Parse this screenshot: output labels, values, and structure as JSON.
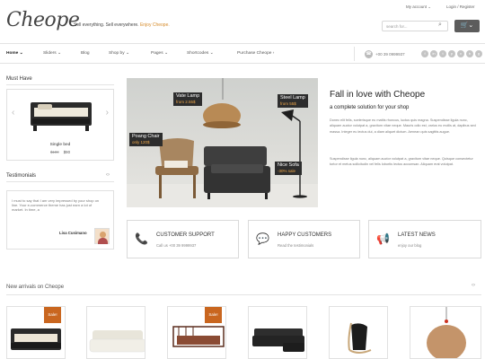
{
  "header": {
    "logo": "Cheope",
    "tagline_main": "Sell everything. Sell everywhere.",
    "tagline_accent": "Enjoy Cheope.",
    "my_account": "My account",
    "login": "Login / Register",
    "search_placeholder": "search for...",
    "cart_label": "🛒"
  },
  "nav": {
    "items": [
      "Home",
      "Sliders",
      "Blog",
      "Shop by",
      "Pages",
      "Shortcodes",
      "Purchase Cheope"
    ],
    "phone": "+00 39 0999937",
    "social": [
      "f",
      "in",
      "t",
      "p",
      "v",
      "b",
      "g"
    ]
  },
  "sidebar": {
    "must_have_title": "Must Have",
    "product_name": "Single bed",
    "old_price": "$100",
    "new_price": "$90",
    "testimonials_title": "Testimonials",
    "testimonial_text": "I must to say that I am very impressed by your shop on line. Your e-commerce theme has just earn a lot of market. In time, a",
    "testimonial_author": "Lisa Cusimano"
  },
  "hero": {
    "labels": [
      {
        "name": "Vate Lamp",
        "price": "from 2.55$"
      },
      {
        "name": "Steel Lamp",
        "price": "from 55$"
      },
      {
        "name": "Poang Chair",
        "price": "only 120$"
      },
      {
        "name": "Nice Sofa",
        "price": "-30% sale"
      }
    ]
  },
  "intro": {
    "title": "Fall in love with Cheope",
    "subtitle": "a complete solution for your shop",
    "para1": "Donec elit felis, scelerisque eu mattis rhoncus, luctus quis magna. Suspendisse ligula nunc, aliquam auctor volutpat a, gravitum vitae neque. Mauris odio est, varius eu mollis at, dapibus sed massa. Integer eu lectus dui, a diam aliquet dictum. Aenean quis sagittis augue.",
    "para2": "Suspendisse ligula nunc, aliquam auctor volutpat a, gravitum vitae neque. Quisque consectetur tortor et metus sollicitudin vel felis lobortis lectus accumsan. Aliquam erat volutpat."
  },
  "features": [
    {
      "icon": "📞",
      "title": "CUSTOMER SUPPORT",
      "sub": "Call us +00 39 9999937"
    },
    {
      "icon": "💬",
      "title": "HAPPY CUSTOMERS",
      "sub": "Read the testimonials"
    },
    {
      "icon": "📢",
      "title": "LATEST NEWS",
      "sub": "enjoy our blog"
    }
  ],
  "new_arrivals": {
    "title": "New arrivals on Cheope",
    "sale_label": "Sale!"
  }
}
